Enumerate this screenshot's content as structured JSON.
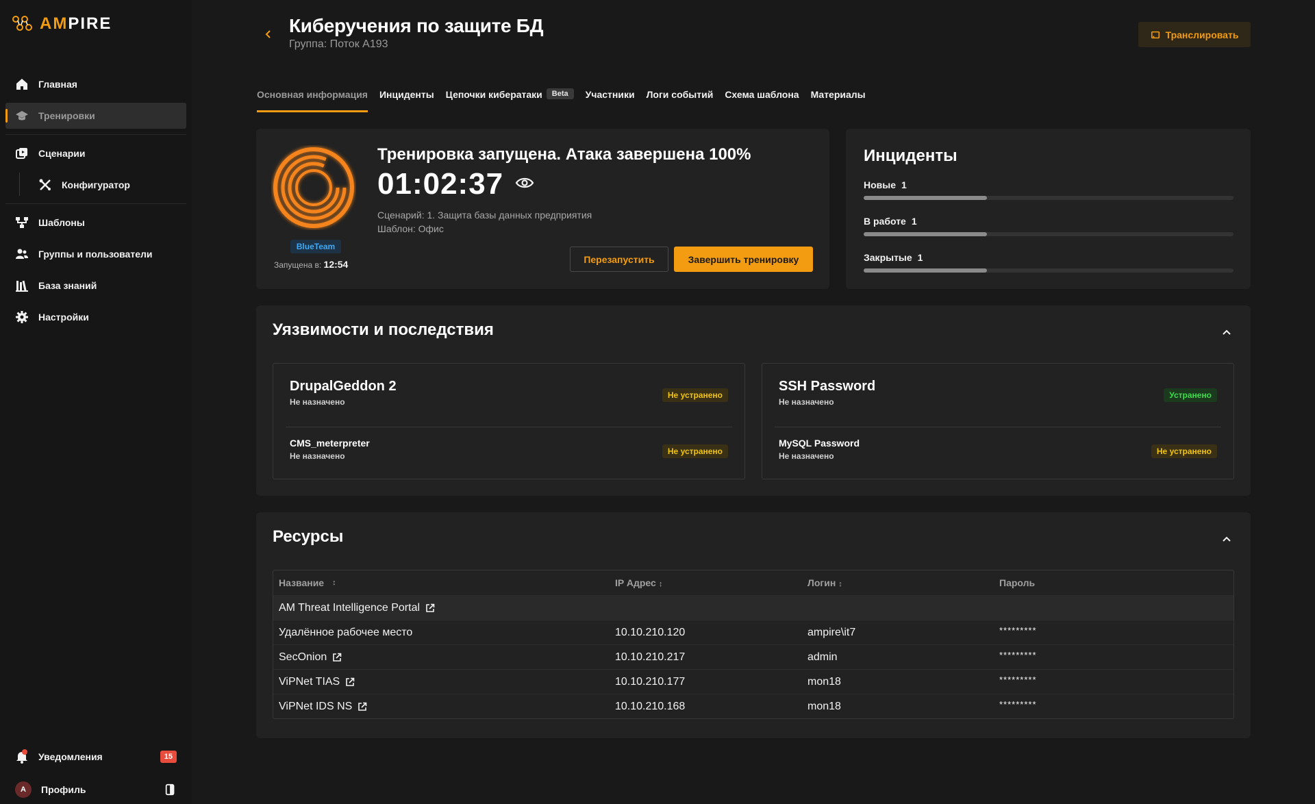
{
  "brand": {
    "prefix": "AM",
    "suffix": "PIRE"
  },
  "sidebar": {
    "items": [
      {
        "label": "Главная",
        "icon": "home-icon"
      },
      {
        "label": "Тренировки",
        "icon": "graduation-cap-icon"
      },
      {
        "label": "Сценарии",
        "icon": "scenario-icon"
      },
      {
        "label": "Конфигуратор",
        "icon": "tools-icon"
      },
      {
        "label": "Шаблоны",
        "icon": "sitemap-icon"
      },
      {
        "label": "Группы и пользователи",
        "icon": "users-icon"
      },
      {
        "label": "База знаний",
        "icon": "library-icon"
      },
      {
        "label": "Настройки",
        "icon": "gear-icon"
      }
    ],
    "notifications": {
      "label": "Уведомления",
      "count": "15"
    },
    "profile": {
      "label": "Профиль",
      "avatar_letter": "A"
    }
  },
  "header": {
    "title": "Киберучения по защите БД",
    "subtitle": "Группа: Поток А193",
    "broadcast_label": "Транслировать"
  },
  "tabs": [
    {
      "label": "Основная информация",
      "active": true
    },
    {
      "label": "Инциденты"
    },
    {
      "label": "Цепочки кибератаки",
      "badge": "Beta"
    },
    {
      "label": "Участники"
    },
    {
      "label": "Логи событий"
    },
    {
      "label": "Схема шаблона"
    },
    {
      "label": "Материалы"
    }
  ],
  "status": {
    "title": "Тренировка запущена. Атака завершена 100%",
    "progress_percent": 100,
    "timer": "01:02:37",
    "scenario": "Сценарий: 1. Защита базы данных предприятия",
    "template": "Шаблон: Офис",
    "team": "BlueTeam",
    "started_label": "Запущена в:",
    "started_time": "12:54",
    "restart_label": "Перезапустить",
    "finish_label": "Завершить тренировку"
  },
  "incidents": {
    "title": "Инциденты",
    "rows": [
      {
        "label": "Новые",
        "count": "1",
        "fill": 0.333
      },
      {
        "label": "В работе",
        "count": "1",
        "fill": 0.333
      },
      {
        "label": "Закрытые",
        "count": "1",
        "fill": 0.333
      }
    ]
  },
  "vulnerabilities": {
    "title": "Уязвимости и последствия",
    "groups": [
      {
        "main": {
          "name": "DrupalGeddon 2",
          "assignee": "Не назначено",
          "status": "Не устранено"
        },
        "sub": {
          "name": "CMS_meterpreter",
          "assignee": "Не назначено",
          "status": "Не устранено"
        }
      },
      {
        "main": {
          "name": "SSH Password",
          "assignee": "Не назначено",
          "status": "Устранено"
        },
        "sub": {
          "name": "MySQL Password",
          "assignee": "Не назначено",
          "status": "Не устранено"
        }
      }
    ]
  },
  "resources": {
    "title": "Ресурсы",
    "columns": [
      "Название",
      "IP Адрес",
      "Логин",
      "Пароль"
    ],
    "rows": [
      {
        "name": "AM Threat Intelligence Portal",
        "ip": "",
        "login": "",
        "password": "",
        "link": true
      },
      {
        "name": "Удалённое рабочее место",
        "ip": "10.10.210.120",
        "login": "ampire\\it7",
        "password": "*********",
        "link": false
      },
      {
        "name": "SecOnion",
        "ip": "10.10.210.217",
        "login": "admin",
        "password": "*********",
        "link": true
      },
      {
        "name": "ViPNet TIAS",
        "ip": "10.10.210.177",
        "login": "mon18",
        "password": "*********",
        "link": true
      },
      {
        "name": "ViPNet IDS NS",
        "ip": "10.10.210.168",
        "login": "mon18",
        "password": "*********",
        "link": true
      }
    ]
  },
  "colors": {
    "accent": "#f39c12",
    "bg": "#191919",
    "card": "#222222",
    "danger": "#e74c3c",
    "ok": "#3ddc4a",
    "warn": "#f1c40f"
  }
}
